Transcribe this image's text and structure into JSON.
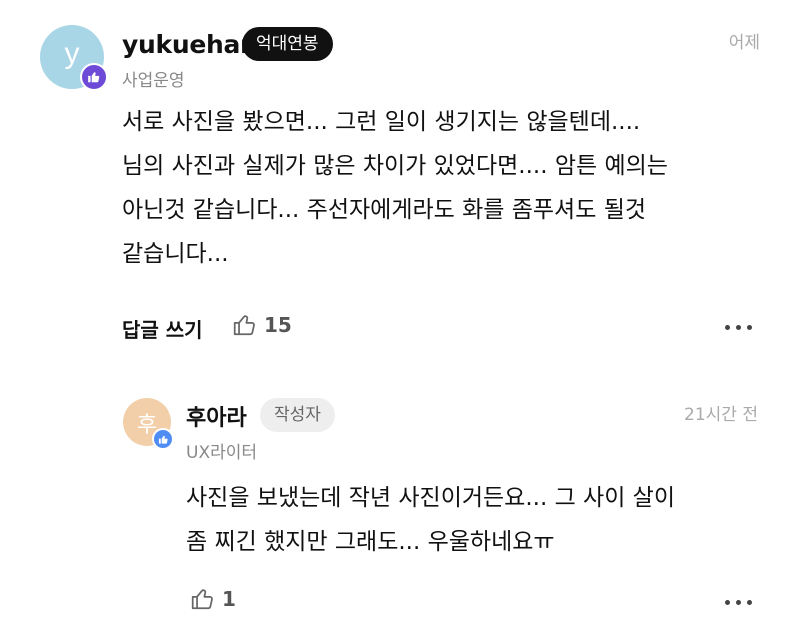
{
  "comment": {
    "avatar_letter": "y",
    "username": "yukuehan",
    "badge": "억대연봉",
    "role": "사업운영",
    "time": "어제",
    "lines": [
      "서로 사진을 봤으면... 그런 일이 생기지는 않을텐데....",
      "님의 사진과 실제가 많은 차이가 있었다면....  암튼 예의는",
      "아닌것 같습니다...  주선자에게라도 화를 좀푸셔도 될것",
      "같습니다..."
    ],
    "reply_label": "답글 쓰기",
    "like_count": "15"
  },
  "reply": {
    "avatar_letter": "후",
    "username": "후아라",
    "badge": "작성자",
    "role": "UX라이터",
    "time": "21시간 전",
    "lines": [
      "사진을 보냈는데 작년 사진이거든요... 그 사이 살이",
      "좀 찌긴 했지만 그래도... 우울하네요ㅠ"
    ],
    "like_count": "1"
  },
  "icons": {
    "avatar_badge": "thumbs-up-icon",
    "like": "thumbs-up-outline-icon",
    "more": "more-dots-icon"
  },
  "colors": {
    "avatar_main": "#a9d6e7",
    "avatar_reply": "#f2cfa8",
    "badge_dark": "#111111",
    "user_badge_purple": "#6d4bd6",
    "user_badge_blue": "#4f8df5"
  }
}
